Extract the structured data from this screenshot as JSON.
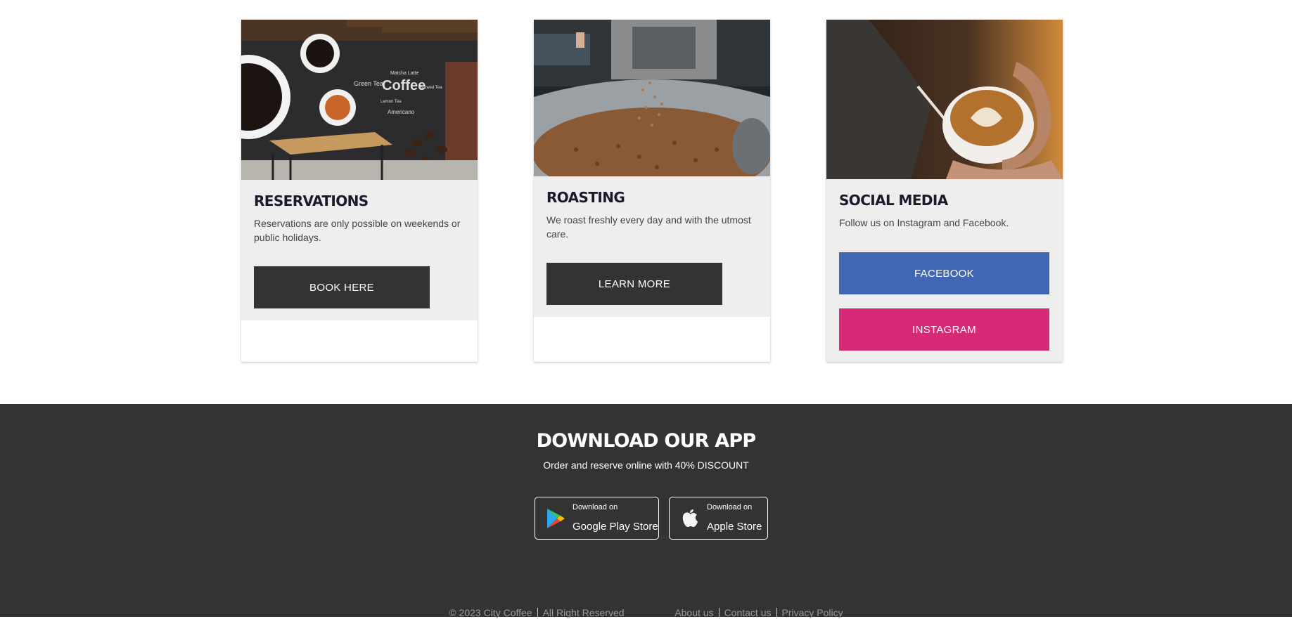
{
  "cards": [
    {
      "title": "RESERVATIONS",
      "text": "Reservations are only possible on weekends or public holidays.",
      "button": "BOOK HERE"
    },
    {
      "title": "ROASTING",
      "text": "We roast freshly every day and with the utmost care.",
      "button": "LEARN MORE"
    },
    {
      "title": "SOCIAL MEDIA",
      "text": "Follow us on Instagram and Facebook.",
      "buttons": [
        "FACEBOOK",
        "INSTAGRAM"
      ]
    }
  ],
  "footer": {
    "title": "DOWNLOAD OUR APP",
    "subtitle": "Order and reserve online with 40% DISCOUNT",
    "stores": [
      {
        "small": "Download on",
        "big": "Google Play Store",
        "icon": "google-play-icon"
      },
      {
        "small": "Download on",
        "big": "Apple Store",
        "icon": "apple-icon"
      }
    ],
    "copyright": "© 2023 City Coffee",
    "rights": "All Right Reserved",
    "links": [
      "About us",
      "Contact us",
      "Privacy Policy"
    ]
  },
  "colors": {
    "dark": "#333333",
    "card_body": "#eeeeee",
    "facebook": "#4267b2",
    "instagram": "#d62976"
  }
}
